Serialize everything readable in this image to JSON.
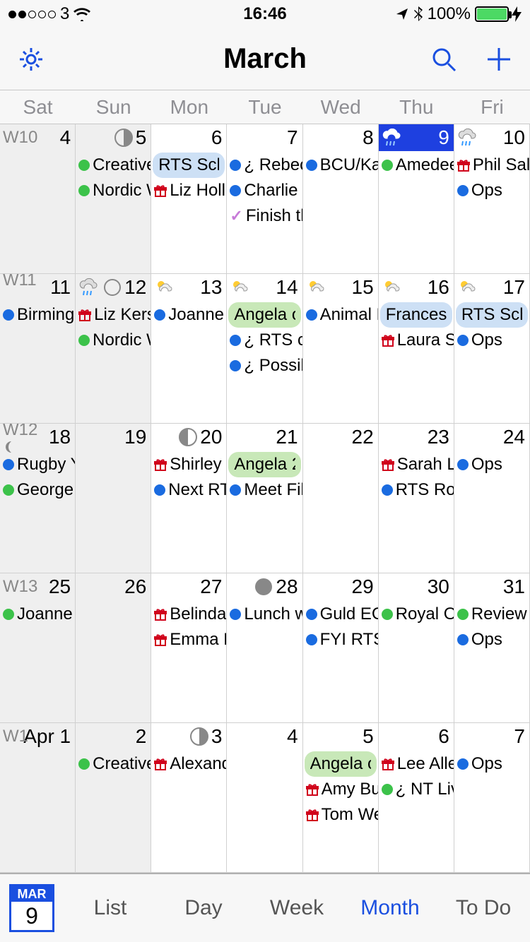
{
  "status": {
    "carrier": "3",
    "signal_dots": 2,
    "time": "16:46",
    "location": true,
    "bluetooth": true,
    "battery_pct": "100%",
    "charging": true
  },
  "nav": {
    "title": "March"
  },
  "weekdays": [
    "Sat",
    "Sun",
    "Mon",
    "Tue",
    "Wed",
    "Thu",
    "Fri"
  ],
  "weeks": [
    {
      "label": "W10",
      "days": [
        {
          "n": "4",
          "weekend": true,
          "wk": "W10"
        },
        {
          "n": "5",
          "weekend": true,
          "moon": "first-quarter",
          "events": [
            {
              "dot": "green",
              "t": "Creative"
            },
            {
              "dot": "green",
              "t": "Nordic W"
            }
          ]
        },
        {
          "n": "6",
          "events": [
            {
              "pill": "blue",
              "t": "RTS Scho"
            },
            {
              "gift": true,
              "t": "Liz Hollid"
            }
          ]
        },
        {
          "n": "7",
          "events": [
            {
              "dot": "blue",
              "t": "¿ Rebecc"
            },
            {
              "dot": "blue",
              "t": "Charlie J"
            },
            {
              "check": true,
              "t": "Finish th"
            }
          ]
        },
        {
          "n": "8",
          "events": [
            {
              "dot": "blue",
              "t": "BCU/Kat"
            }
          ]
        },
        {
          "n": "9",
          "today": true,
          "weather": "rain-night",
          "events": [
            {
              "dot": "green",
              "t": "Amedee"
            }
          ]
        },
        {
          "n": "10",
          "weather": "rain",
          "events": [
            {
              "gift": true,
              "t": "Phil Salce"
            },
            {
              "dot": "blue",
              "t": "Ops"
            }
          ]
        }
      ]
    },
    {
      "label": "W11",
      "days": [
        {
          "n": "11",
          "weekend": true,
          "wk": "W11",
          "wkicon": "moon-last",
          "events": [
            {
              "dot": "blue",
              "t": "Birmingh"
            }
          ]
        },
        {
          "n": "12",
          "weekend": true,
          "weather": "rain",
          "moon": "full-outline",
          "events": [
            {
              "gift": true,
              "t": "Liz Kersh"
            },
            {
              "dot": "green",
              "t": "Nordic W"
            }
          ]
        },
        {
          "n": "13",
          "weather": "partly",
          "events": [
            {
              "dot": "blue",
              "t": "Joanne F"
            }
          ]
        },
        {
          "n": "14",
          "weather": "partly",
          "events": [
            {
              "pill": "green",
              "t": "Angela ov"
            },
            {
              "dot": "blue",
              "t": "¿ RTS co"
            },
            {
              "dot": "blue",
              "t": "¿ Possibl"
            }
          ]
        },
        {
          "n": "15",
          "weather": "partly",
          "events": [
            {
              "dot": "blue",
              "t": "Animal L"
            }
          ]
        },
        {
          "n": "16",
          "weather": "partly",
          "events": [
            {
              "pill": "blue",
              "t": "Frances D"
            },
            {
              "gift": true,
              "t": "Laura Sp"
            }
          ]
        },
        {
          "n": "17",
          "weather": "partly",
          "events": [
            {
              "pill": "blue",
              "t": "RTS Schoo"
            },
            {
              "dot": "blue",
              "t": "Ops"
            }
          ]
        }
      ]
    },
    {
      "label": "W12",
      "days": [
        {
          "n": "18",
          "weekend": true,
          "wk": "W12",
          "wkicon": "moon-wane",
          "events": [
            {
              "dot": "blue",
              "t": "Rugby Yo"
            },
            {
              "dot": "green",
              "t": "George S"
            }
          ]
        },
        {
          "n": "19",
          "weekend": true
        },
        {
          "n": "20",
          "moon": "last-quarter",
          "events": [
            {
              "gift": true,
              "t": "Shirley R"
            },
            {
              "dot": "blue",
              "t": "Next RTS"
            }
          ]
        },
        {
          "n": "21",
          "events": [
            {
              "pill": "green",
              "t": "Angela 2"
            },
            {
              "dot": "blue",
              "t": "Meet File"
            }
          ]
        },
        {
          "n": "22"
        },
        {
          "n": "23",
          "events": [
            {
              "gift": true,
              "t": "Sarah Le"
            },
            {
              "dot": "blue",
              "t": "RTS Roa"
            }
          ]
        },
        {
          "n": "24",
          "events": [
            {
              "dot": "blue",
              "t": "Ops"
            }
          ]
        }
      ]
    },
    {
      "label": "W13",
      "days": [
        {
          "n": "25",
          "weekend": true,
          "wk": "W13",
          "events": [
            {
              "dot": "green",
              "t": "Joanne a"
            }
          ]
        },
        {
          "n": "26",
          "weekend": true
        },
        {
          "n": "27",
          "events": [
            {
              "gift": true,
              "t": "Belinda L"
            },
            {
              "gift": true,
              "t": "Emma M"
            }
          ]
        },
        {
          "n": "28",
          "moon": "new",
          "events": [
            {
              "dot": "blue",
              "t": "Lunch w"
            }
          ]
        },
        {
          "n": "29",
          "events": [
            {
              "dot": "blue",
              "t": "Guld EC"
            },
            {
              "dot": "blue",
              "t": "FYI RTS"
            }
          ]
        },
        {
          "n": "30",
          "events": [
            {
              "dot": "green",
              "t": "Royal Op"
            }
          ]
        },
        {
          "n": "31",
          "events": [
            {
              "dot": "green",
              "t": "Review of"
            },
            {
              "dot": "blue",
              "t": "Ops"
            }
          ]
        }
      ]
    },
    {
      "label": "W1",
      "days": [
        {
          "n": "Apr 1",
          "weekend": true,
          "wk": "W1"
        },
        {
          "n": "2",
          "weekend": true,
          "events": [
            {
              "dot": "green",
              "t": "Creative"
            }
          ]
        },
        {
          "n": "3",
          "moon": "first-quarter",
          "events": [
            {
              "gift": true,
              "t": "Alexandr"
            }
          ]
        },
        {
          "n": "4"
        },
        {
          "n": "5",
          "events": [
            {
              "pill": "green",
              "t": "Angela ov"
            },
            {
              "gift": true,
              "t": "Amy Bus"
            },
            {
              "gift": true,
              "t": "Tom Wer"
            }
          ]
        },
        {
          "n": "6",
          "events": [
            {
              "gift": true,
              "t": "Lee Aller"
            },
            {
              "dot": "green",
              "t": "¿ NT Live"
            }
          ]
        },
        {
          "n": "7",
          "events": [
            {
              "dot": "blue",
              "t": "Ops"
            }
          ]
        }
      ]
    }
  ],
  "tabbar": {
    "today_month": "MAR",
    "today_day": "9",
    "tabs": [
      "List",
      "Day",
      "Week",
      "Month",
      "To Do"
    ],
    "active": "Month"
  }
}
